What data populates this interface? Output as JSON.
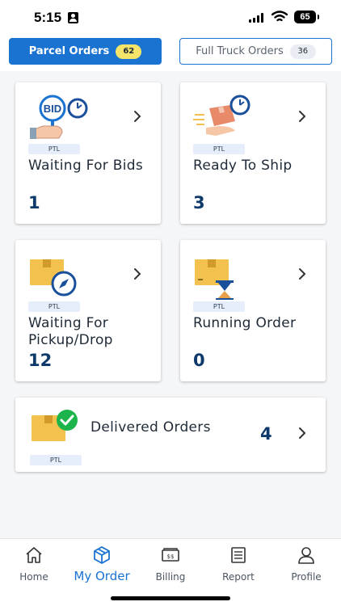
{
  "status_bar": {
    "time": "5:15",
    "battery": "65"
  },
  "tabs": [
    {
      "label": "Parcel Orders",
      "count": "62",
      "active": true
    },
    {
      "label": "Full Truck Orders",
      "count": "36",
      "active": false
    }
  ],
  "cards": [
    {
      "badge": "PTL",
      "title": "Waiting For Bids",
      "count": "1",
      "icon": "bid-stopwatch-icon"
    },
    {
      "badge": "PTL",
      "title": "Ready To Ship",
      "count": "3",
      "icon": "box-hand-stopwatch-icon"
    },
    {
      "badge": "PTL",
      "title": "Waiting For Pickup/Drop",
      "count": "12",
      "icon": "box-compass-icon"
    },
    {
      "badge": "PTL",
      "title": "Running Order",
      "count": "0",
      "icon": "box-hourglass-icon"
    },
    {
      "badge": "PTL",
      "title": "Delivered Orders",
      "count": "4",
      "icon": "box-check-icon"
    }
  ],
  "bottom_nav": [
    {
      "label": "Home",
      "icon": "home-icon",
      "active": false
    },
    {
      "label": "My Order",
      "icon": "cube-icon",
      "active": true
    },
    {
      "label": "Billing",
      "icon": "billing-icon",
      "active": false
    },
    {
      "label": "Report",
      "icon": "report-icon",
      "active": false
    },
    {
      "label": "Profile",
      "icon": "profile-icon",
      "active": false
    }
  ],
  "colors": {
    "primary": "#1a73d1",
    "count": "#0e3a6b",
    "badge": "#f5e46a",
    "box": "#f2c14e"
  }
}
